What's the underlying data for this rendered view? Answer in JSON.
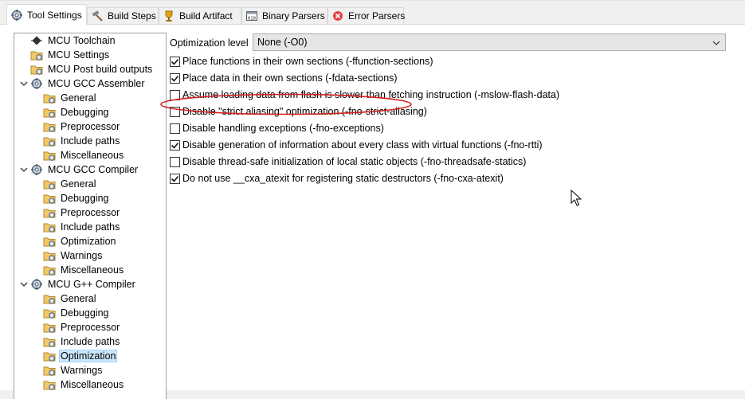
{
  "tabs": [
    {
      "label": "Tool Settings",
      "icon": "gear-icon",
      "active": true
    },
    {
      "label": "Build Steps",
      "icon": "hammer-icon",
      "active": false
    },
    {
      "label": "Build Artifact",
      "icon": "trophy-icon",
      "active": false
    },
    {
      "label": "Binary Parsers",
      "icon": "binary-icon",
      "active": false
    },
    {
      "label": "Error Parsers",
      "icon": "error-icon",
      "active": false
    }
  ],
  "tree": [
    {
      "label": "MCU Toolchain",
      "icon": "chip-icon",
      "level": 0,
      "twisty": false,
      "selected": false
    },
    {
      "label": "MCU Settings",
      "icon": "folder-gear-icon",
      "level": 0,
      "twisty": false,
      "selected": false
    },
    {
      "label": "MCU Post build outputs",
      "icon": "folder-gear-icon",
      "level": 0,
      "twisty": false,
      "selected": false
    },
    {
      "label": "MCU GCC Assembler",
      "icon": "gear-icon",
      "level": 0,
      "twisty": true,
      "selected": false
    },
    {
      "label": "General",
      "icon": "folder-gear-icon",
      "level": 1,
      "twisty": false,
      "selected": false
    },
    {
      "label": "Debugging",
      "icon": "folder-gear-icon",
      "level": 1,
      "twisty": false,
      "selected": false
    },
    {
      "label": "Preprocessor",
      "icon": "folder-gear-icon",
      "level": 1,
      "twisty": false,
      "selected": false
    },
    {
      "label": "Include paths",
      "icon": "folder-gear-icon",
      "level": 1,
      "twisty": false,
      "selected": false
    },
    {
      "label": "Miscellaneous",
      "icon": "folder-gear-icon",
      "level": 1,
      "twisty": false,
      "selected": false
    },
    {
      "label": "MCU GCC Compiler",
      "icon": "gear-icon",
      "level": 0,
      "twisty": true,
      "selected": false
    },
    {
      "label": "General",
      "icon": "folder-gear-icon",
      "level": 1,
      "twisty": false,
      "selected": false
    },
    {
      "label": "Debugging",
      "icon": "folder-gear-icon",
      "level": 1,
      "twisty": false,
      "selected": false
    },
    {
      "label": "Preprocessor",
      "icon": "folder-gear-icon",
      "level": 1,
      "twisty": false,
      "selected": false
    },
    {
      "label": "Include paths",
      "icon": "folder-gear-icon",
      "level": 1,
      "twisty": false,
      "selected": false
    },
    {
      "label": "Optimization",
      "icon": "folder-gear-icon",
      "level": 1,
      "twisty": false,
      "selected": false
    },
    {
      "label": "Warnings",
      "icon": "folder-gear-icon",
      "level": 1,
      "twisty": false,
      "selected": false
    },
    {
      "label": "Miscellaneous",
      "icon": "folder-gear-icon",
      "level": 1,
      "twisty": false,
      "selected": false
    },
    {
      "label": "MCU G++ Compiler",
      "icon": "gear-icon",
      "level": 0,
      "twisty": true,
      "selected": false
    },
    {
      "label": "General",
      "icon": "folder-gear-icon",
      "level": 1,
      "twisty": false,
      "selected": false
    },
    {
      "label": "Debugging",
      "icon": "folder-gear-icon",
      "level": 1,
      "twisty": false,
      "selected": false
    },
    {
      "label": "Preprocessor",
      "icon": "folder-gear-icon",
      "level": 1,
      "twisty": false,
      "selected": false
    },
    {
      "label": "Include paths",
      "icon": "folder-gear-icon",
      "level": 1,
      "twisty": false,
      "selected": false
    },
    {
      "label": "Optimization",
      "icon": "folder-gear-icon",
      "level": 1,
      "twisty": false,
      "selected": true
    },
    {
      "label": "Warnings",
      "icon": "folder-gear-icon",
      "level": 1,
      "twisty": false,
      "selected": false
    },
    {
      "label": "Miscellaneous",
      "icon": "folder-gear-icon",
      "level": 1,
      "twisty": false,
      "selected": false
    }
  ],
  "optimization": {
    "label": "Optimization level",
    "value": "None (-O0)"
  },
  "options": [
    {
      "label": "Place functions in their own sections (-ffunction-sections)",
      "checked": true
    },
    {
      "label": "Place data in their own sections (-fdata-sections)",
      "checked": true
    },
    {
      "label": "Assume loading data from flash is slower than fetching instruction (-mslow-flash-data)",
      "checked": false
    },
    {
      "label": "Disable \"strict aliasing\" optimization (-fno-strict-aliasing)",
      "checked": false
    },
    {
      "label": "Disable handling exceptions (-fno-exceptions)",
      "checked": false,
      "highlighted": true
    },
    {
      "label": "Disable generation of information about every class with virtual functions (-fno-rtti)",
      "checked": true
    },
    {
      "label": "Disable thread-safe initialization of local static objects (-fno-threadsafe-statics)",
      "checked": false
    },
    {
      "label": "Do not use __cxa_atexit for registering static destructors (-fno-cxa-atexit)",
      "checked": true
    }
  ],
  "colors": {
    "highlight_ellipse": "#d42020",
    "selection_bg": "#cce8ff",
    "selection_border": "#99d1ff"
  }
}
